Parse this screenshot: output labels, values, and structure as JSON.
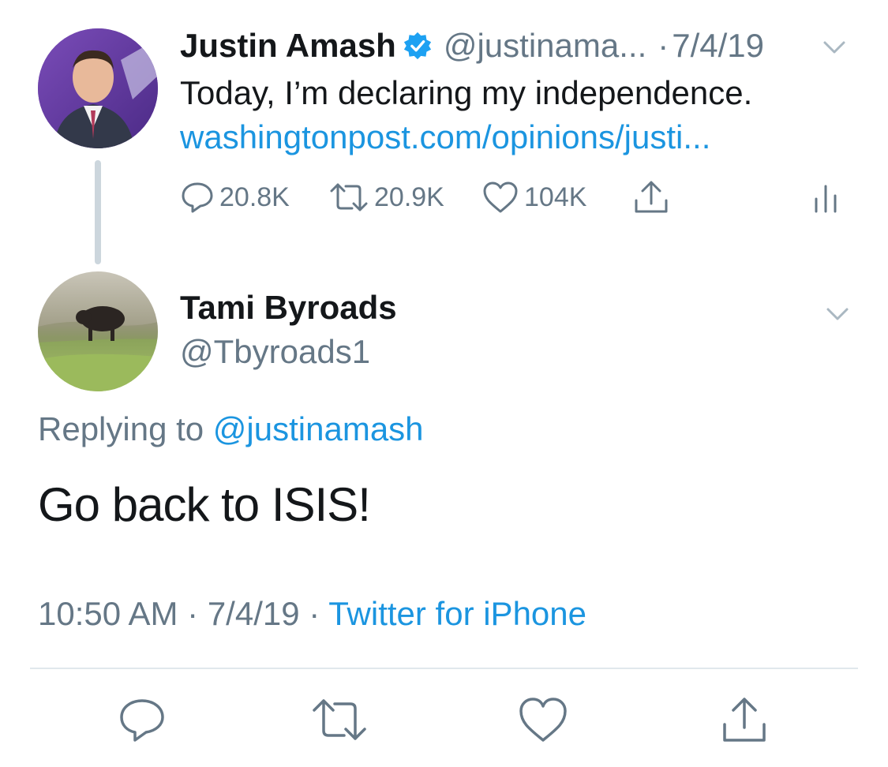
{
  "parent_tweet": {
    "author_name": "Justin Amash",
    "handle": "@justinama...",
    "dot": "·",
    "date": "7/4/19",
    "text": "Today, I’m declaring my independence.",
    "link": "washingtonpost.com/opinions/justi...",
    "reply_count": "20.8K",
    "retweet_count": "20.9K",
    "like_count": "104K",
    "verified_icon": "verified-badge-icon",
    "icons": [
      "reply-icon",
      "retweet-icon",
      "like-icon",
      "share-icon",
      "stats-icon",
      "caret-down-icon"
    ]
  },
  "reply_tweet": {
    "author_name": "Tami Byroads",
    "handle": "@Tbyroads1",
    "replying_prefix": "Replying to",
    "replying_mention": "@justinamash",
    "body": "Go back to ISIS!",
    "time": "10:50 AM",
    "sep1": "·",
    "date": "7/4/19",
    "sep2": "·",
    "source": "Twitter for iPhone"
  },
  "bottom_actions": [
    "reply-icon",
    "retweet-icon",
    "like-icon",
    "share-icon"
  ],
  "colors": {
    "text": "#14171a",
    "secondary": "#657786",
    "link": "#1b95e0",
    "thread_line": "#ccd6dd",
    "divider": "#e1e8ed"
  }
}
